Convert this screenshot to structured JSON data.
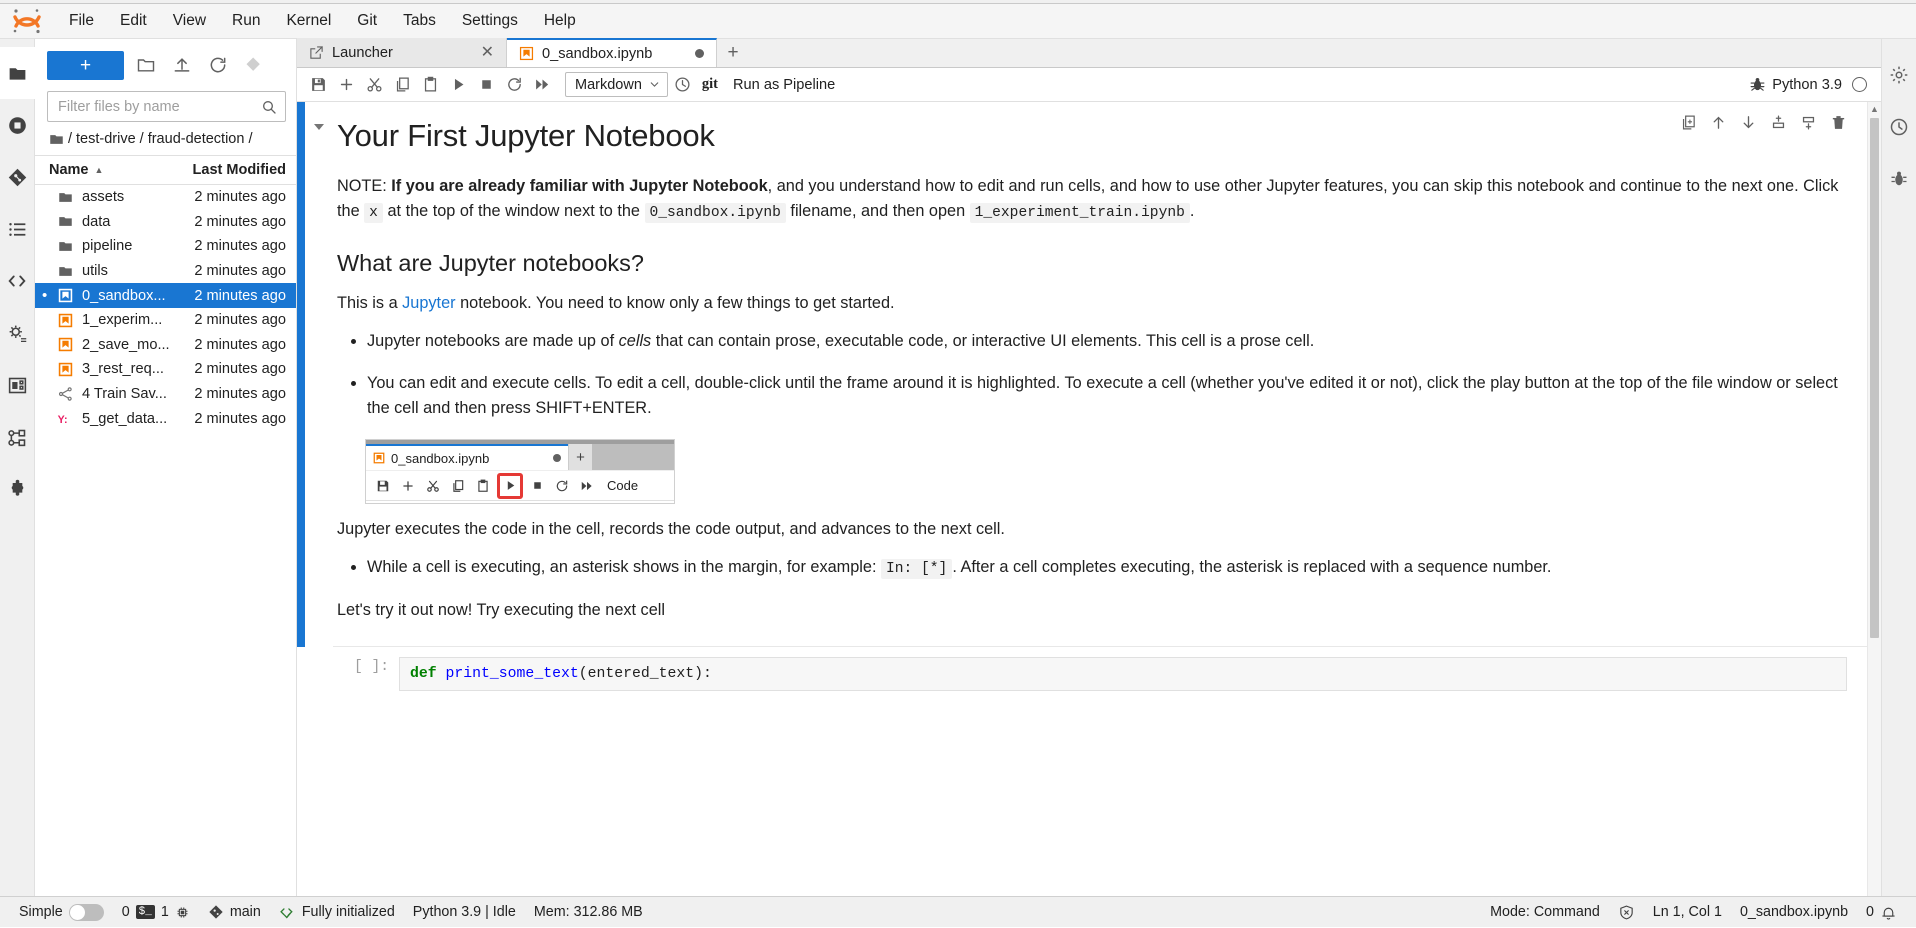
{
  "menu": {
    "items": [
      "File",
      "Edit",
      "View",
      "Run",
      "Kernel",
      "Git",
      "Tabs",
      "Settings",
      "Help"
    ]
  },
  "filebrowser": {
    "new_label": "+",
    "filter_placeholder": "Filter files by name",
    "filter_value": "",
    "breadcrumb": [
      "/",
      "test-drive",
      "/",
      "fraud-detection",
      "/"
    ],
    "columns": {
      "name": "Name",
      "modified": "Last Modified"
    },
    "rows": [
      {
        "name": "assets",
        "modified": "2 minutes ago",
        "icon": "folder-icon",
        "selected": false
      },
      {
        "name": "data",
        "modified": "2 minutes ago",
        "icon": "folder-icon",
        "selected": false
      },
      {
        "name": "pipeline",
        "modified": "2 minutes ago",
        "icon": "folder-icon",
        "selected": false
      },
      {
        "name": "utils",
        "modified": "2 minutes ago",
        "icon": "folder-icon",
        "selected": false
      },
      {
        "name": "0_sandbox...",
        "modified": "2 minutes ago",
        "icon": "notebook-icon",
        "selected": true
      },
      {
        "name": "1_experim...",
        "modified": "2 minutes ago",
        "icon": "notebook-icon",
        "selected": false
      },
      {
        "name": "2_save_mo...",
        "modified": "2 minutes ago",
        "icon": "notebook-icon",
        "selected": false
      },
      {
        "name": "3_rest_req...",
        "modified": "2 minutes ago",
        "icon": "notebook-icon",
        "selected": false
      },
      {
        "name": "4 Train Sav...",
        "modified": "2 minutes ago",
        "icon": "pipeline-icon",
        "selected": false
      },
      {
        "name": "5_get_data...",
        "modified": "2 minutes ago",
        "icon": "yaml-icon",
        "selected": false
      }
    ]
  },
  "tabs": [
    {
      "label": "Launcher",
      "icon": "launcher-icon",
      "active": false,
      "closeable": true
    },
    {
      "label": "0_sandbox.ipynb",
      "icon": "notebook-icon",
      "active": true,
      "dirty": true
    }
  ],
  "toolbar": {
    "celltype": "Markdown",
    "git_label": "git",
    "run_pipeline_label": "Run as Pipeline",
    "kernel_name": "Python 3.9"
  },
  "notebook": {
    "title": "Your First Jupyter Notebook",
    "note": {
      "prefix": "NOTE: ",
      "bold": "If you are already familiar with Jupyter Notebook",
      "mid1": ", and you understand how to edit and run cells, and how to use other Jupyter features, you can skip this notebook and continue to the next one. Click the ",
      "code1": "x",
      "mid2": " at the top of the window next to the ",
      "code2": "0_sandbox.ipynb",
      "mid3": " filename, and then open ",
      "code3": "1_experiment_train.ipynb",
      "suffix": "."
    },
    "section_heading": "What are Jupyter notebooks?",
    "intro": {
      "pre": "This is a ",
      "link": "Jupyter",
      "post": " notebook. You need to know only a few things to get started."
    },
    "bullets": {
      "b1_pre": "Jupyter notebooks are made up of ",
      "b1_em": "cells",
      "b1_post": " that can contain prose, executable code, or interactive UI elements. This cell is a prose cell.",
      "b2": "You can edit and execute cells. To edit a cell, double-click until the frame around it is highlighted. To execute a cell (whether you've edited it or not), click the play button at the top of the file window or select the cell and then press SHIFT+ENTER.",
      "b3_pre": "While a cell is executing, an asterisk shows in the margin, for example: ",
      "b3_code": "In: [*]",
      "b3_post": ". After a cell completes executing, the asterisk is replaced with a sequence number."
    },
    "after_image": "Jupyter executes the code in the cell, records the code output, and advances to the next cell.",
    "closing": "Let's try it out now! Try executing the next cell",
    "embedded_shot": {
      "tab_label": "0_sandbox.ipynb",
      "plus": "+",
      "celltype": "Code"
    },
    "code_cell": {
      "prompt": "[ ]:",
      "kw": "def",
      "fname": " print_some_text",
      "args": "(entered_text):"
    }
  },
  "statusbar": {
    "simple_label": "Simple",
    "kernels_count": "0",
    "terminals_count": "1",
    "git_branch": "main",
    "init_status": "Fully initialized",
    "kernel_status": "Python 3.9 | Idle",
    "memory": "Mem: 312.86 MB",
    "mode": "Mode: Command",
    "cursor": "Ln 1, Col 1",
    "filename": "0_sandbox.ipynb",
    "notifications": "0"
  },
  "colors": {
    "accent": "#1976d2",
    "orange": "#f57c00",
    "red": "#e53935",
    "pink": "#e91e63"
  }
}
